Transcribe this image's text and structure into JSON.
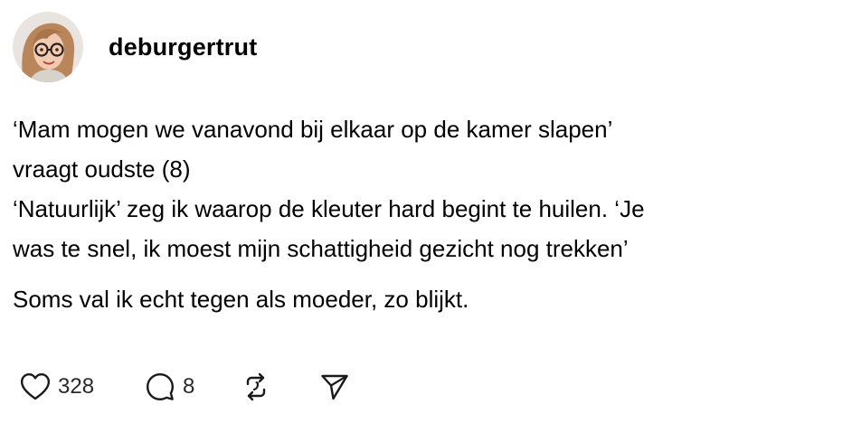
{
  "post": {
    "username": "deburgertrut",
    "avatar_icon": "profile-avatar-illustration",
    "paragraphs": [
      {
        "lines": [
          "‘Mam mogen we vanavond bij elkaar op de kamer slapen’",
          "vraagt oudste (8)",
          "‘Natuurlijk’ zeg ik waarop de kleuter hard begint te huilen. ‘Je",
          "was te snel, ik moest mijn schattigheid gezicht nog trekken’"
        ]
      },
      {
        "lines": [
          "Soms val ik echt tegen als moeder, zo blijkt."
        ]
      }
    ],
    "actions": {
      "like": {
        "icon": "heart-icon",
        "count": "328"
      },
      "reply": {
        "icon": "comment-icon",
        "count": "8"
      },
      "repost": {
        "icon": "repost-icon"
      },
      "share": {
        "icon": "send-icon"
      }
    }
  }
}
